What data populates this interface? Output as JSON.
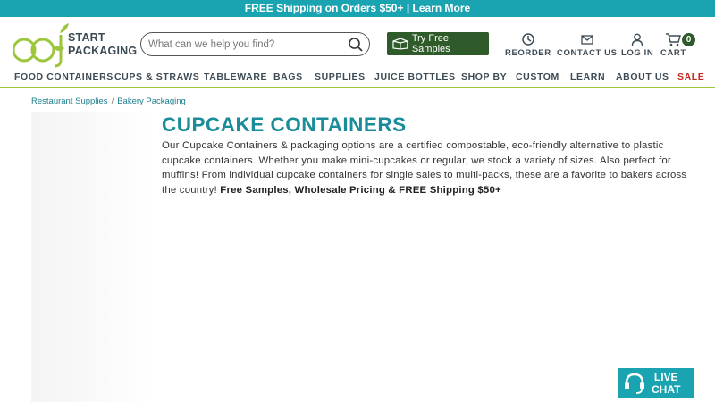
{
  "promo": {
    "text": "FREE Shipping on Orders $50+ | ",
    "link": "Learn More"
  },
  "logo": {
    "line1": "START",
    "line2": "PACKAGING"
  },
  "search": {
    "placeholder": "What can we help you find?"
  },
  "samples_button": "Try Free Samples",
  "utility": {
    "reorder": "REORDER",
    "contact": "CONTACT US",
    "login": "LOG IN",
    "cart": "CART",
    "cart_count": "0"
  },
  "nav": [
    "FOOD CONTAINERS",
    "CUPS & STRAWS",
    "TABLEWARE",
    "BAGS",
    "SUPPLIES",
    "JUICE BOTTLES",
    "SHOP BY",
    "CUSTOM",
    "LEARN",
    "ABOUT US",
    "SALE"
  ],
  "breadcrumb": {
    "item1": "Restaurant Supplies",
    "separator": "/",
    "item2": "Bakery Packaging"
  },
  "page": {
    "title": "CUPCAKE CONTAINERS",
    "description": "Our Cupcake Containers & packaging options are a certified compostable, eco-friendly alternative to plastic cupcake containers. Whether you make mini-cupcakes or regular, we stock a variety of sizes.  Also perfect for muffins!  From individual cupcake containers for single sales to multi-packs, these are a favorite to bakers across the country! ",
    "description_bold": "Free Samples, Wholesale Pricing & FREE Shipping $50+"
  },
  "live_chat": {
    "line1": "LIVE",
    "line2": "CHAT"
  },
  "colors": {
    "teal": "#1aa3b0",
    "dark_green": "#2f5b2b",
    "lime": "#9cc63b",
    "sale_red": "#c4281e"
  }
}
